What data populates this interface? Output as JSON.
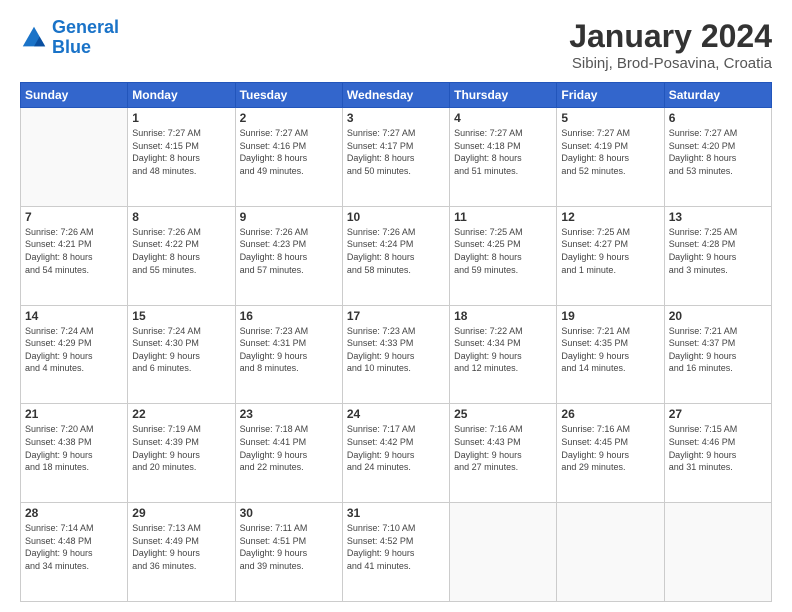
{
  "logo": {
    "text_general": "General",
    "text_blue": "Blue"
  },
  "header": {
    "title": "January 2024",
    "subtitle": "Sibinj, Brod-Posavina, Croatia"
  },
  "weekdays": [
    "Sunday",
    "Monday",
    "Tuesday",
    "Wednesday",
    "Thursday",
    "Friday",
    "Saturday"
  ],
  "weeks": [
    [
      {
        "day": "",
        "info": ""
      },
      {
        "day": "1",
        "info": "Sunrise: 7:27 AM\nSunset: 4:15 PM\nDaylight: 8 hours\nand 48 minutes."
      },
      {
        "day": "2",
        "info": "Sunrise: 7:27 AM\nSunset: 4:16 PM\nDaylight: 8 hours\nand 49 minutes."
      },
      {
        "day": "3",
        "info": "Sunrise: 7:27 AM\nSunset: 4:17 PM\nDaylight: 8 hours\nand 50 minutes."
      },
      {
        "day": "4",
        "info": "Sunrise: 7:27 AM\nSunset: 4:18 PM\nDaylight: 8 hours\nand 51 minutes."
      },
      {
        "day": "5",
        "info": "Sunrise: 7:27 AM\nSunset: 4:19 PM\nDaylight: 8 hours\nand 52 minutes."
      },
      {
        "day": "6",
        "info": "Sunrise: 7:27 AM\nSunset: 4:20 PM\nDaylight: 8 hours\nand 53 minutes."
      }
    ],
    [
      {
        "day": "7",
        "info": "Sunrise: 7:26 AM\nSunset: 4:21 PM\nDaylight: 8 hours\nand 54 minutes."
      },
      {
        "day": "8",
        "info": "Sunrise: 7:26 AM\nSunset: 4:22 PM\nDaylight: 8 hours\nand 55 minutes."
      },
      {
        "day": "9",
        "info": "Sunrise: 7:26 AM\nSunset: 4:23 PM\nDaylight: 8 hours\nand 57 minutes."
      },
      {
        "day": "10",
        "info": "Sunrise: 7:26 AM\nSunset: 4:24 PM\nDaylight: 8 hours\nand 58 minutes."
      },
      {
        "day": "11",
        "info": "Sunrise: 7:25 AM\nSunset: 4:25 PM\nDaylight: 8 hours\nand 59 minutes."
      },
      {
        "day": "12",
        "info": "Sunrise: 7:25 AM\nSunset: 4:27 PM\nDaylight: 9 hours\nand 1 minute."
      },
      {
        "day": "13",
        "info": "Sunrise: 7:25 AM\nSunset: 4:28 PM\nDaylight: 9 hours\nand 3 minutes."
      }
    ],
    [
      {
        "day": "14",
        "info": "Sunrise: 7:24 AM\nSunset: 4:29 PM\nDaylight: 9 hours\nand 4 minutes."
      },
      {
        "day": "15",
        "info": "Sunrise: 7:24 AM\nSunset: 4:30 PM\nDaylight: 9 hours\nand 6 minutes."
      },
      {
        "day": "16",
        "info": "Sunrise: 7:23 AM\nSunset: 4:31 PM\nDaylight: 9 hours\nand 8 minutes."
      },
      {
        "day": "17",
        "info": "Sunrise: 7:23 AM\nSunset: 4:33 PM\nDaylight: 9 hours\nand 10 minutes."
      },
      {
        "day": "18",
        "info": "Sunrise: 7:22 AM\nSunset: 4:34 PM\nDaylight: 9 hours\nand 12 minutes."
      },
      {
        "day": "19",
        "info": "Sunrise: 7:21 AM\nSunset: 4:35 PM\nDaylight: 9 hours\nand 14 minutes."
      },
      {
        "day": "20",
        "info": "Sunrise: 7:21 AM\nSunset: 4:37 PM\nDaylight: 9 hours\nand 16 minutes."
      }
    ],
    [
      {
        "day": "21",
        "info": "Sunrise: 7:20 AM\nSunset: 4:38 PM\nDaylight: 9 hours\nand 18 minutes."
      },
      {
        "day": "22",
        "info": "Sunrise: 7:19 AM\nSunset: 4:39 PM\nDaylight: 9 hours\nand 20 minutes."
      },
      {
        "day": "23",
        "info": "Sunrise: 7:18 AM\nSunset: 4:41 PM\nDaylight: 9 hours\nand 22 minutes."
      },
      {
        "day": "24",
        "info": "Sunrise: 7:17 AM\nSunset: 4:42 PM\nDaylight: 9 hours\nand 24 minutes."
      },
      {
        "day": "25",
        "info": "Sunrise: 7:16 AM\nSunset: 4:43 PM\nDaylight: 9 hours\nand 27 minutes."
      },
      {
        "day": "26",
        "info": "Sunrise: 7:16 AM\nSunset: 4:45 PM\nDaylight: 9 hours\nand 29 minutes."
      },
      {
        "day": "27",
        "info": "Sunrise: 7:15 AM\nSunset: 4:46 PM\nDaylight: 9 hours\nand 31 minutes."
      }
    ],
    [
      {
        "day": "28",
        "info": "Sunrise: 7:14 AM\nSunset: 4:48 PM\nDaylight: 9 hours\nand 34 minutes."
      },
      {
        "day": "29",
        "info": "Sunrise: 7:13 AM\nSunset: 4:49 PM\nDaylight: 9 hours\nand 36 minutes."
      },
      {
        "day": "30",
        "info": "Sunrise: 7:11 AM\nSunset: 4:51 PM\nDaylight: 9 hours\nand 39 minutes."
      },
      {
        "day": "31",
        "info": "Sunrise: 7:10 AM\nSunset: 4:52 PM\nDaylight: 9 hours\nand 41 minutes."
      },
      {
        "day": "",
        "info": ""
      },
      {
        "day": "",
        "info": ""
      },
      {
        "day": "",
        "info": ""
      }
    ]
  ]
}
